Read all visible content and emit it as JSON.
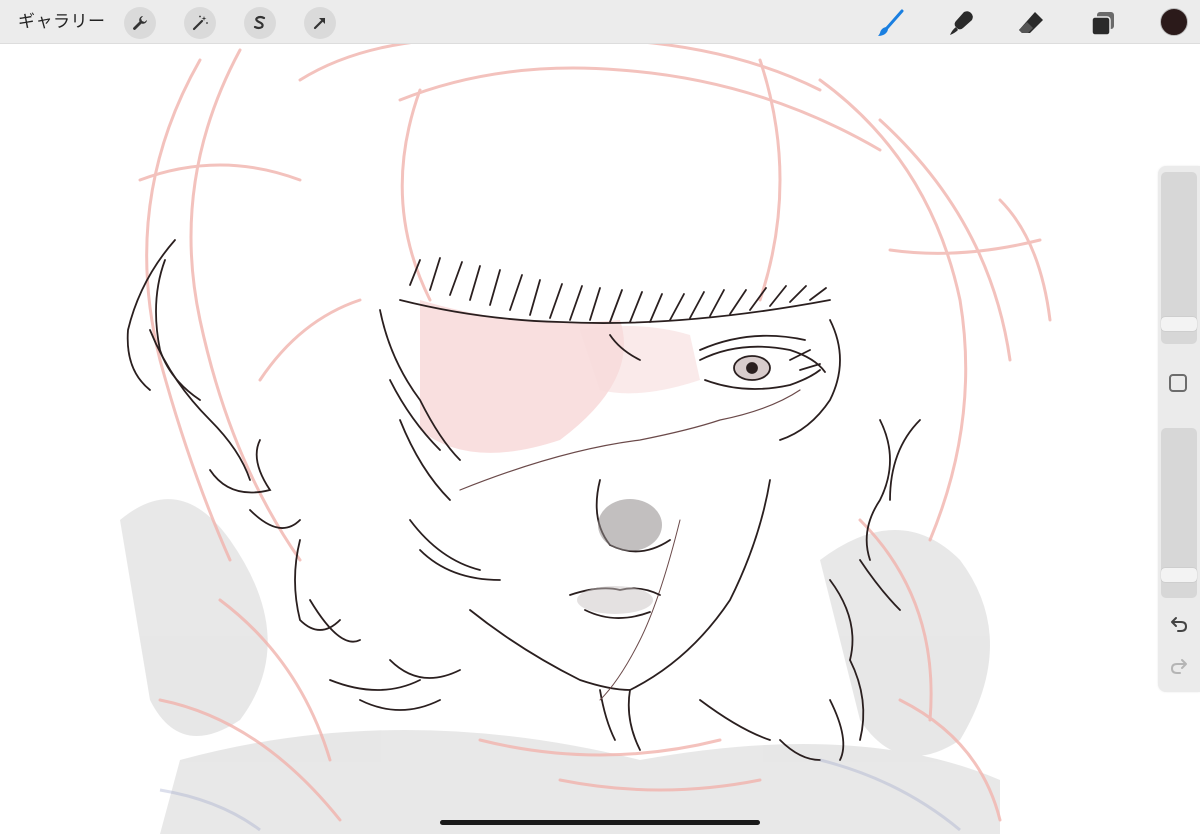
{
  "app": "Procreate",
  "toolbar": {
    "gallery_label": "ギャラリー",
    "left_tools": [
      "wrench-icon",
      "magic-wand-icon",
      "selection-icon",
      "transform-arrow-icon"
    ],
    "right_tools": [
      "brush-icon",
      "smudge-icon",
      "eraser-icon",
      "layers-icon"
    ],
    "active_tool": "brush-icon",
    "current_color": "#2b1a1a"
  },
  "sidebar": {
    "brush_size_level": 0.08,
    "opacity_level": 0.1,
    "undo_icon": "undo-icon",
    "redo_icon": "redo-icon"
  },
  "colors": {
    "accent": "#1a7fe0",
    "toolbar_bg": "#ececec",
    "sketch_red": "#f3b7b3",
    "line_art": "#2a1f1f"
  }
}
